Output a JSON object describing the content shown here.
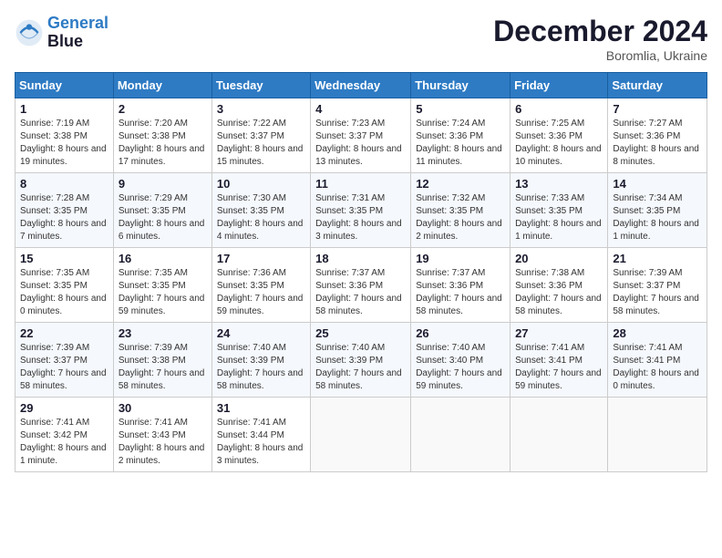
{
  "header": {
    "logo_line1": "General",
    "logo_line2": "Blue",
    "month_title": "December 2024",
    "subtitle": "Boromlia, Ukraine"
  },
  "days_of_week": [
    "Sunday",
    "Monday",
    "Tuesday",
    "Wednesday",
    "Thursday",
    "Friday",
    "Saturday"
  ],
  "weeks": [
    [
      {
        "day": "1",
        "sunrise": "7:19 AM",
        "sunset": "3:38 PM",
        "daylight": "8 hours and 19 minutes."
      },
      {
        "day": "2",
        "sunrise": "7:20 AM",
        "sunset": "3:38 PM",
        "daylight": "8 hours and 17 minutes."
      },
      {
        "day": "3",
        "sunrise": "7:22 AM",
        "sunset": "3:37 PM",
        "daylight": "8 hours and 15 minutes."
      },
      {
        "day": "4",
        "sunrise": "7:23 AM",
        "sunset": "3:37 PM",
        "daylight": "8 hours and 13 minutes."
      },
      {
        "day": "5",
        "sunrise": "7:24 AM",
        "sunset": "3:36 PM",
        "daylight": "8 hours and 11 minutes."
      },
      {
        "day": "6",
        "sunrise": "7:25 AM",
        "sunset": "3:36 PM",
        "daylight": "8 hours and 10 minutes."
      },
      {
        "day": "7",
        "sunrise": "7:27 AM",
        "sunset": "3:36 PM",
        "daylight": "8 hours and 8 minutes."
      }
    ],
    [
      {
        "day": "8",
        "sunrise": "7:28 AM",
        "sunset": "3:35 PM",
        "daylight": "8 hours and 7 minutes."
      },
      {
        "day": "9",
        "sunrise": "7:29 AM",
        "sunset": "3:35 PM",
        "daylight": "8 hours and 6 minutes."
      },
      {
        "day": "10",
        "sunrise": "7:30 AM",
        "sunset": "3:35 PM",
        "daylight": "8 hours and 4 minutes."
      },
      {
        "day": "11",
        "sunrise": "7:31 AM",
        "sunset": "3:35 PM",
        "daylight": "8 hours and 3 minutes."
      },
      {
        "day": "12",
        "sunrise": "7:32 AM",
        "sunset": "3:35 PM",
        "daylight": "8 hours and 2 minutes."
      },
      {
        "day": "13",
        "sunrise": "7:33 AM",
        "sunset": "3:35 PM",
        "daylight": "8 hours and 1 minute."
      },
      {
        "day": "14",
        "sunrise": "7:34 AM",
        "sunset": "3:35 PM",
        "daylight": "8 hours and 1 minute."
      }
    ],
    [
      {
        "day": "15",
        "sunrise": "7:35 AM",
        "sunset": "3:35 PM",
        "daylight": "8 hours and 0 minutes."
      },
      {
        "day": "16",
        "sunrise": "7:35 AM",
        "sunset": "3:35 PM",
        "daylight": "7 hours and 59 minutes."
      },
      {
        "day": "17",
        "sunrise": "7:36 AM",
        "sunset": "3:35 PM",
        "daylight": "7 hours and 59 minutes."
      },
      {
        "day": "18",
        "sunrise": "7:37 AM",
        "sunset": "3:36 PM",
        "daylight": "7 hours and 58 minutes."
      },
      {
        "day": "19",
        "sunrise": "7:37 AM",
        "sunset": "3:36 PM",
        "daylight": "7 hours and 58 minutes."
      },
      {
        "day": "20",
        "sunrise": "7:38 AM",
        "sunset": "3:36 PM",
        "daylight": "7 hours and 58 minutes."
      },
      {
        "day": "21",
        "sunrise": "7:39 AM",
        "sunset": "3:37 PM",
        "daylight": "7 hours and 58 minutes."
      }
    ],
    [
      {
        "day": "22",
        "sunrise": "7:39 AM",
        "sunset": "3:37 PM",
        "daylight": "7 hours and 58 minutes."
      },
      {
        "day": "23",
        "sunrise": "7:39 AM",
        "sunset": "3:38 PM",
        "daylight": "7 hours and 58 minutes."
      },
      {
        "day": "24",
        "sunrise": "7:40 AM",
        "sunset": "3:39 PM",
        "daylight": "7 hours and 58 minutes."
      },
      {
        "day": "25",
        "sunrise": "7:40 AM",
        "sunset": "3:39 PM",
        "daylight": "7 hours and 58 minutes."
      },
      {
        "day": "26",
        "sunrise": "7:40 AM",
        "sunset": "3:40 PM",
        "daylight": "7 hours and 59 minutes."
      },
      {
        "day": "27",
        "sunrise": "7:41 AM",
        "sunset": "3:41 PM",
        "daylight": "7 hours and 59 minutes."
      },
      {
        "day": "28",
        "sunrise": "7:41 AM",
        "sunset": "3:41 PM",
        "daylight": "8 hours and 0 minutes."
      }
    ],
    [
      {
        "day": "29",
        "sunrise": "7:41 AM",
        "sunset": "3:42 PM",
        "daylight": "8 hours and 1 minute."
      },
      {
        "day": "30",
        "sunrise": "7:41 AM",
        "sunset": "3:43 PM",
        "daylight": "8 hours and 2 minutes."
      },
      {
        "day": "31",
        "sunrise": "7:41 AM",
        "sunset": "3:44 PM",
        "daylight": "8 hours and 3 minutes."
      },
      null,
      null,
      null,
      null
    ]
  ]
}
